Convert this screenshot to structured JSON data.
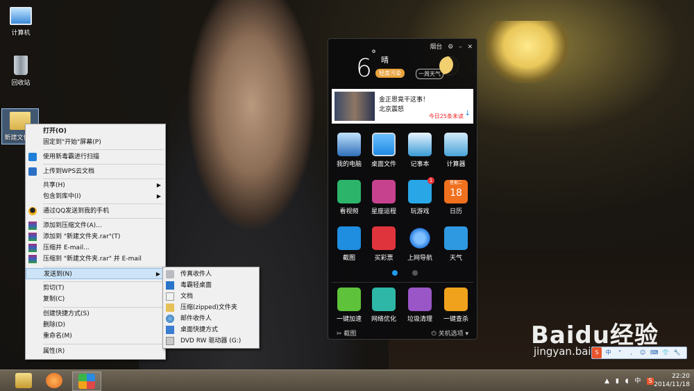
{
  "desktop": {
    "icons": [
      {
        "label": "计算机"
      },
      {
        "label": "回收站"
      },
      {
        "label": "新建文件夹"
      }
    ]
  },
  "context_menu": {
    "items": [
      {
        "label": "打开(O)"
      },
      {
        "label": "固定到\"开始\"屏幕(P)"
      },
      {
        "label": "使用新毒霸进行扫描"
      },
      {
        "label": "上传到WPS云文档"
      },
      {
        "label": "共享(H)"
      },
      {
        "label": "包含到库中(I)"
      },
      {
        "label": "通过QQ发送到我的手机"
      },
      {
        "label": "添加到压缩文件(A)..."
      },
      {
        "label": "添加到 \"新建文件夹.rar\"(T)"
      },
      {
        "label": "压缩并 E-mail..."
      },
      {
        "label": "压缩到 \"新建文件夹.rar\" 并 E-mail"
      },
      {
        "label": "发送到(N)"
      },
      {
        "label": "剪切(T)"
      },
      {
        "label": "复制(C)"
      },
      {
        "label": "创建快捷方式(S)"
      },
      {
        "label": "删除(D)"
      },
      {
        "label": "重命名(M)"
      },
      {
        "label": "属性(R)"
      }
    ],
    "submenu_arrow": "▶"
  },
  "sendto_menu": {
    "items": [
      {
        "label": "传真收件人"
      },
      {
        "label": "毒霸轻桌面"
      },
      {
        "label": "文档"
      },
      {
        "label": "压缩(zipped)文件夹"
      },
      {
        "label": "邮件收件人"
      },
      {
        "label": "桌面快捷方式"
      },
      {
        "label": "DVD RW 驱动器 (G:)"
      }
    ]
  },
  "widget": {
    "location": "烟台",
    "topbar_icons": [
      "⚙",
      "–",
      "✕"
    ],
    "temperature": "6",
    "degree": "°",
    "condition": "晴",
    "aqi": "轻度污染",
    "week_btn": "一周天气",
    "news": {
      "title": "金正恩竟干这事！",
      "subtitle": "北京震怒",
      "count": "今日25条未读",
      "arrow": "↓"
    },
    "tiles": [
      {
        "label": "我的电脑",
        "color": "#2f6fb8"
      },
      {
        "label": "桌面文件",
        "color": "#1f8ae3"
      },
      {
        "label": "记事本",
        "color": "#3a9bd6"
      },
      {
        "label": "计算器",
        "color": "#4aa3d9"
      },
      {
        "label": "看视频",
        "color": "#2cb46a"
      },
      {
        "label": "星座运程",
        "color": "#c6428f"
      },
      {
        "label": "玩游戏",
        "color": "#29a6e6"
      },
      {
        "label": "日历",
        "color": "#f0701e"
      },
      {
        "label": "截图",
        "color": "#1f8de0"
      },
      {
        "label": "买彩票",
        "color": "#e0343c"
      },
      {
        "label": "上网导航",
        "color": "#2b7de0"
      },
      {
        "label": "天气",
        "color": "#2e98e0"
      },
      {
        "label": "一键加速",
        "color": "#5ec33a"
      },
      {
        "label": "网络优化",
        "color": "#2eb7a6"
      },
      {
        "label": "垃圾清理",
        "color": "#9a56c7"
      },
      {
        "label": "一键查杀",
        "color": "#f0a21c"
      }
    ],
    "game_badge": "1",
    "calendar_month": "星期二",
    "calendar_day": "18",
    "bottom_left": "截图",
    "bottom_right": "关机选项",
    "dots_colors": [
      "#1e9be8",
      "#555555"
    ]
  },
  "watermark": {
    "text": "Baidu经验",
    "url": "jingyan.baidu.com"
  },
  "ime_bar": [
    "S",
    "中",
    "°",
    ",",
    "☺",
    "⌨",
    "👕",
    "🔧"
  ],
  "taskbar": {
    "tray": [
      "▲",
      "中",
      "S"
    ],
    "time": "22:20",
    "date": "2014/11/18"
  }
}
